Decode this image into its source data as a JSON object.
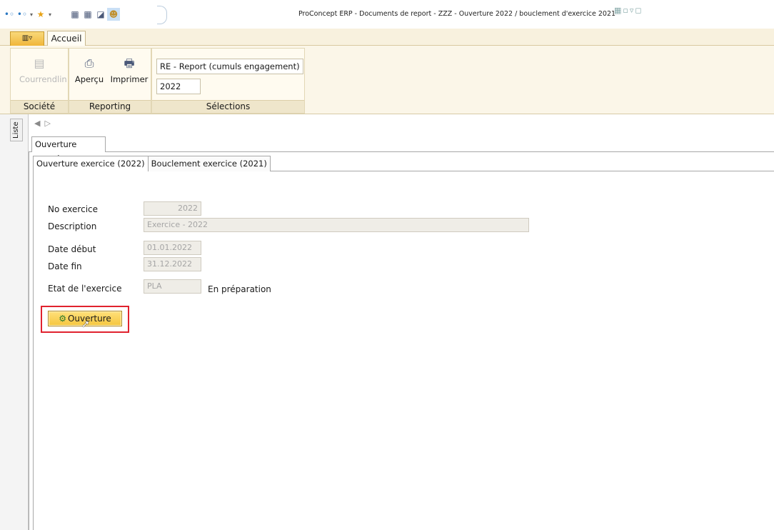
{
  "window": {
    "title": "ProConcept ERP - Documents de report - ZZZ - Ouverture 2022 / bouclement d'exercice 2021"
  },
  "ribbon": {
    "tabs": [
      {
        "label": "Accueil"
      }
    ],
    "groups": {
      "societe": {
        "label": "Société",
        "button_label": "Courrendlin"
      },
      "reporting": {
        "label": "Reporting",
        "apercu_label": "Aperçu",
        "imprimer_label": "Imprimer"
      },
      "selections": {
        "label": "Sélections",
        "report_value": "RE - Report (cumuls engagement) ENC",
        "year_value": "2022"
      }
    }
  },
  "side": {
    "liste_label": "Liste"
  },
  "main": {
    "outer_tab": "Ouverture exercice",
    "inner_tabs": [
      "Ouverture exercice (2022)",
      "Bouclement exercice (2021)"
    ],
    "form": {
      "no_exercice": {
        "label": "No exercice",
        "value": "2022"
      },
      "description": {
        "label": "Description",
        "value": "Exercice - 2022"
      },
      "date_debut": {
        "label": "Date début",
        "value": "01.01.2022"
      },
      "date_fin": {
        "label": "Date fin",
        "value": "31.12.2022"
      },
      "etat": {
        "label": "Etat de l'exercice",
        "value": "PLA",
        "text": "En préparation"
      }
    },
    "action_button": "Ouverture"
  },
  "colors": {
    "highlight": "#e0222e",
    "button_yellow": "#f5c63f",
    "ribbon_bg": "#fbf6e8"
  }
}
